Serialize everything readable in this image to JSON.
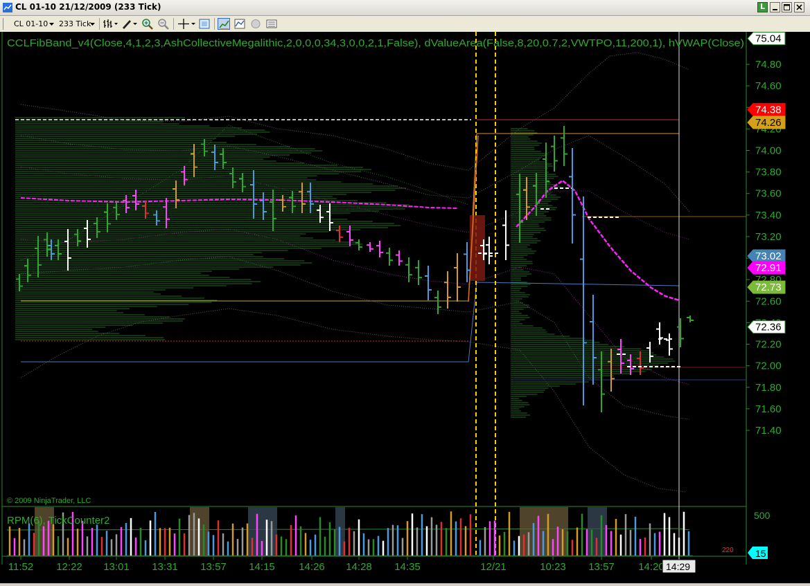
{
  "window": {
    "title": "CL 01-10  21/12/2009 (233 Tick)",
    "buttons": [
      "L",
      "minimize",
      "maximize",
      "close"
    ]
  },
  "toolbar": {
    "instrument": "CL 01-10",
    "interval": "233 Tick",
    "icons": [
      "bar-style-icon",
      "draw-tool-icon",
      "zoom-in-icon",
      "zoom-out-icon",
      "crosshair-icon",
      "properties-icon",
      "indicators-icon",
      "strategies-icon",
      "data-box-icon",
      "chart-trader-icon"
    ]
  },
  "chart": {
    "indicator_label": "CCLFibBand_v4(Close,4,1,2,3,AshCollectiveMegalithic,2,0,0,0,34,3,0,0,2,1,False),  dValueArea(False,8,20,0.7,2,VWTPO,11,200,1),  hVWAP(Close)",
    "copyright": "© 2009 NinjaTrader, LLC",
    "lower_panel_label": "RPM(6), TickCounter2",
    "tick_counter_value": "220",
    "price_axis_labels": [
      "74.80",
      "74.60",
      "74.40",
      "74.20",
      "74.00",
      "73.80",
      "73.60",
      "73.40",
      "73.20",
      "73.00",
      "72.80",
      "72.60",
      "72.40",
      "72.20",
      "72.00",
      "71.80",
      "71.60",
      "71.40"
    ],
    "lower_axis_label": "500",
    "time_axis_labels": [
      "11:52",
      "12:22",
      "13:01",
      "13:31",
      "13:57",
      "14:15",
      "14:26",
      "14:28",
      "14:35",
      "12/21",
      "10:23",
      "13:57",
      "14:20"
    ],
    "cursor_time": "14:29",
    "price_markers": [
      {
        "label": "75.04",
        "bg": "#ffffff",
        "fg": "#000000",
        "price": 75.04
      },
      {
        "label": "74.38",
        "bg": "#ff0000",
        "fg": "#ffffff",
        "price": 74.38
      },
      {
        "label": "74.26",
        "bg": "#d4a017",
        "fg": "#000000",
        "price": 74.26
      },
      {
        "label": "73.02",
        "bg": "#4682b4",
        "fg": "#ffffff",
        "price": 73.02
      },
      {
        "label": "72.91",
        "bg": "#ff00ff",
        "fg": "#ffffff",
        "price": 72.91
      },
      {
        "label": "72.73",
        "bg": "#7cba3a",
        "fg": "#ffffff",
        "price": 72.73
      },
      {
        "label": "72.36",
        "bg": "#ffffff",
        "fg": "#000000",
        "price": 72.36
      }
    ],
    "lower_marker": {
      "label": "15",
      "bg": "#00ffff",
      "fg": "#000000"
    }
  }
}
